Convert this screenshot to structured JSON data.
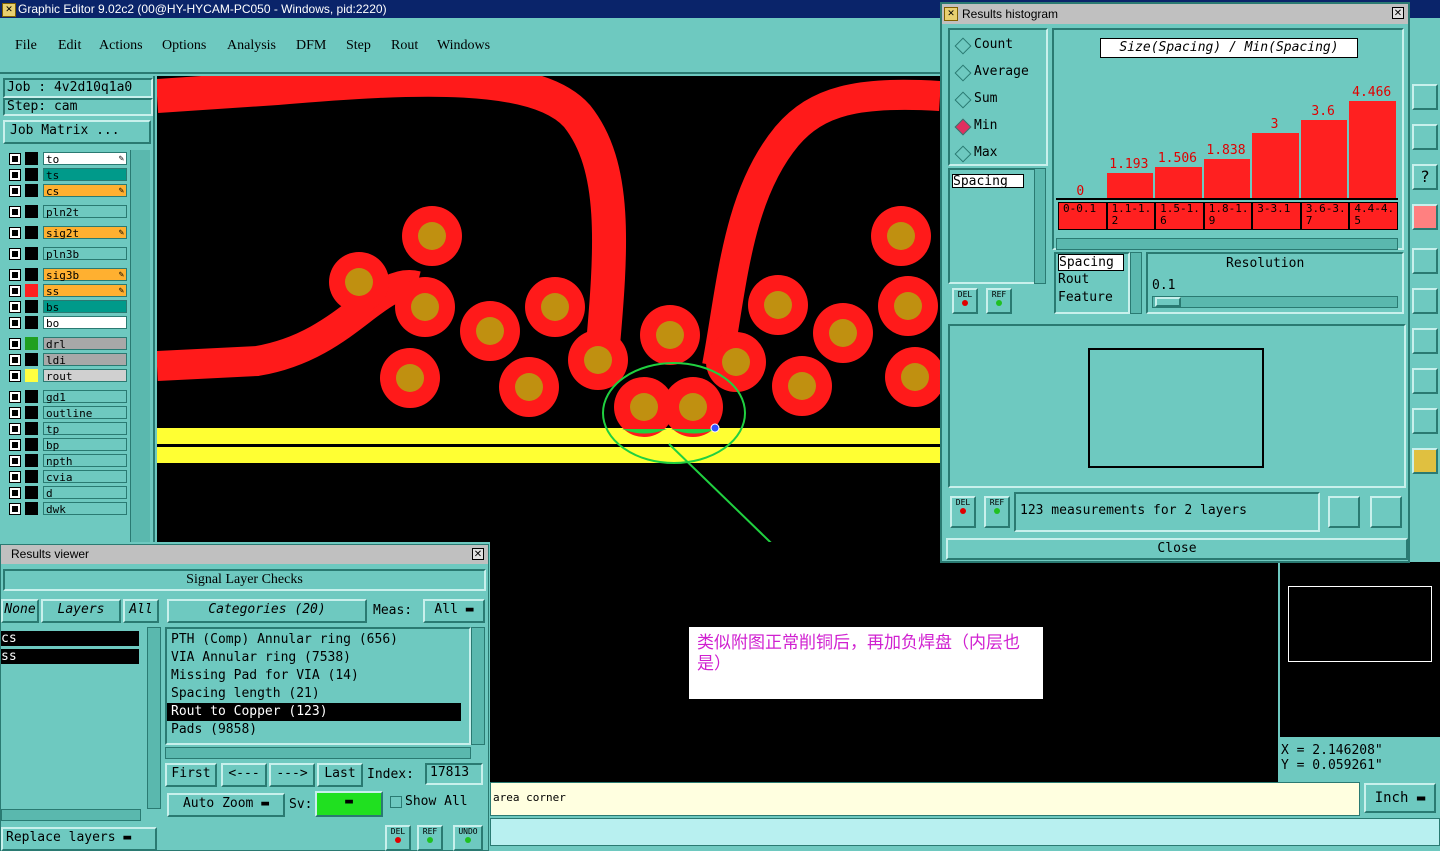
{
  "app": {
    "title": "Graphic Editor 9.02c2 (00@HY-HYCAM-PC050 - Windows, pid:2220)"
  },
  "menu": [
    "File",
    "Edit",
    "Actions",
    "Options",
    "Analysis",
    "DFM",
    "Step",
    "Rout",
    "Windows"
  ],
  "job": {
    "job_label": "Job : 4v2d10q1a0",
    "step_label": "Step: cam",
    "matrix_button": "Job Matrix ..."
  },
  "layers": [
    {
      "name": "to",
      "color": "#ffffff",
      "bg": "#ffffff",
      "mark": true
    },
    {
      "name": "ts",
      "color": "#009a8a",
      "bg": "#009a8a",
      "mark": false
    },
    {
      "name": "cs",
      "color": "#ffb030",
      "bg": "#ffb030",
      "mark": true
    },
    {
      "name": "pln2t",
      "color": "#6ec9c0",
      "bg": "#6ec9c0",
      "mark": false
    },
    {
      "name": "sig2t",
      "color": "#ffb030",
      "bg": "#ffb030",
      "mark": true
    },
    {
      "name": "pln3b",
      "color": "#6ec9c0",
      "bg": "#6ec9c0",
      "mark": false
    },
    {
      "name": "sig3b",
      "color": "#ffb030",
      "bg": "#ffb030",
      "mark": true
    },
    {
      "name": "ss",
      "color": "#ffb030",
      "bg": "#ffb030",
      "mark": true
    },
    {
      "name": "bs",
      "color": "#009a8a",
      "bg": "#009a8a",
      "mark": false
    },
    {
      "name": "bo",
      "color": "#ffffff",
      "bg": "#ffffff",
      "mark": false
    },
    {
      "name": "drl",
      "color": "#a8a8a8",
      "bg": "#a8a8a8",
      "mark": false
    },
    {
      "name": "ldi",
      "color": "#a8a8a8",
      "bg": "#a8a8a8",
      "mark": false
    },
    {
      "name": "rout",
      "color": "#d0d0d0",
      "bg": "#d0d0d0",
      "mark": false
    },
    {
      "name": "gd1",
      "color": "#6ec9c0",
      "bg": "#6ec9c0",
      "mark": false
    },
    {
      "name": "outline",
      "color": "#6ec9c0",
      "bg": "#6ec9c0",
      "mark": false
    },
    {
      "name": "tp",
      "color": "#6ec9c0",
      "bg": "#6ec9c0",
      "mark": false
    },
    {
      "name": "bp",
      "color": "#6ec9c0",
      "bg": "#6ec9c0",
      "mark": false
    },
    {
      "name": "npth",
      "color": "#6ec9c0",
      "bg": "#6ec9c0",
      "mark": false
    },
    {
      "name": "cvia",
      "color": "#6ec9c0",
      "bg": "#6ec9c0",
      "mark": false
    },
    {
      "name": "d",
      "color": "#6ec9c0",
      "bg": "#6ec9c0",
      "mark": false
    },
    {
      "name": "dwk",
      "color": "#6ec9c0",
      "bg": "#6ec9c0",
      "mark": false
    }
  ],
  "results_viewer": {
    "title": "Results viewer",
    "heading": "Signal Layer Checks",
    "none_btn": "None",
    "layers_btn": "Layers",
    "all_btn": "All",
    "categories_btn": "Categories (20)",
    "meas_label": "Meas:",
    "meas_value": "All",
    "layer_list": [
      "cs",
      "ss"
    ],
    "categories": [
      "PTH (Comp) Annular ring (656)",
      "VIA Annular ring (7538)",
      "Missing Pad for VIA (14)",
      "Spacing length (21)",
      "Rout to Copper (123)",
      "Pads (9858)"
    ],
    "selected_category": "Rout to Copper (123)",
    "first": "First",
    "prev": "<---",
    "next": "--->",
    "last": "Last",
    "index_label": "Index:",
    "index_value": "17813",
    "auto_zoom": "Auto Zoom",
    "sv_label": "Sv:",
    "show_all": "Show All",
    "replace_layers": "Replace layers",
    "del": "DEL",
    "ref": "REF",
    "undo": "UNDO"
  },
  "histogram": {
    "title": "Results histogram",
    "options": [
      "Count",
      "Average",
      "Sum",
      "Min",
      "Max"
    ],
    "selected_option": "Min",
    "chart_title": "Size(Spacing) / Min(Spacing)",
    "list_item": "Spacing",
    "resolution_list": [
      "Spacing",
      "Rout",
      "Feature"
    ],
    "resolution_label": "Resolution",
    "resolution_value": "0.1",
    "measurements_text": "123 measurements for 2 layers",
    "close_btn": "Close",
    "del": "DEL",
    "ref": "REF"
  },
  "chart_data": {
    "type": "bar",
    "title": "Size(Spacing) / Min(Spacing)",
    "categories": [
      "0-0.1",
      "1.1-1.2",
      "1.5-1.6",
      "1.8-1.9",
      "3-3.1",
      "3.6-3.7",
      "4.4-4.5"
    ],
    "values": [
      0,
      1.193,
      1.506,
      1.838,
      3,
      3.6,
      4.466
    ],
    "labels": [
      "0",
      "1.193",
      "1.506",
      "1.838",
      "3",
      "3.6",
      "4.466"
    ],
    "color": "#ff2020"
  },
  "annotation": {
    "text": "类似附图正常削铜后，再加负焊盘（内层也是）"
  },
  "status": {
    "prompt": "area corner",
    "units": "Inch",
    "x": "X = 2.146208\"",
    "y": "Y = 0.059261\""
  },
  "colors": {
    "copper": "#ff1a1a",
    "pad_center": "#c09010",
    "rout": "#ffff33",
    "highlight": "#20d040"
  }
}
